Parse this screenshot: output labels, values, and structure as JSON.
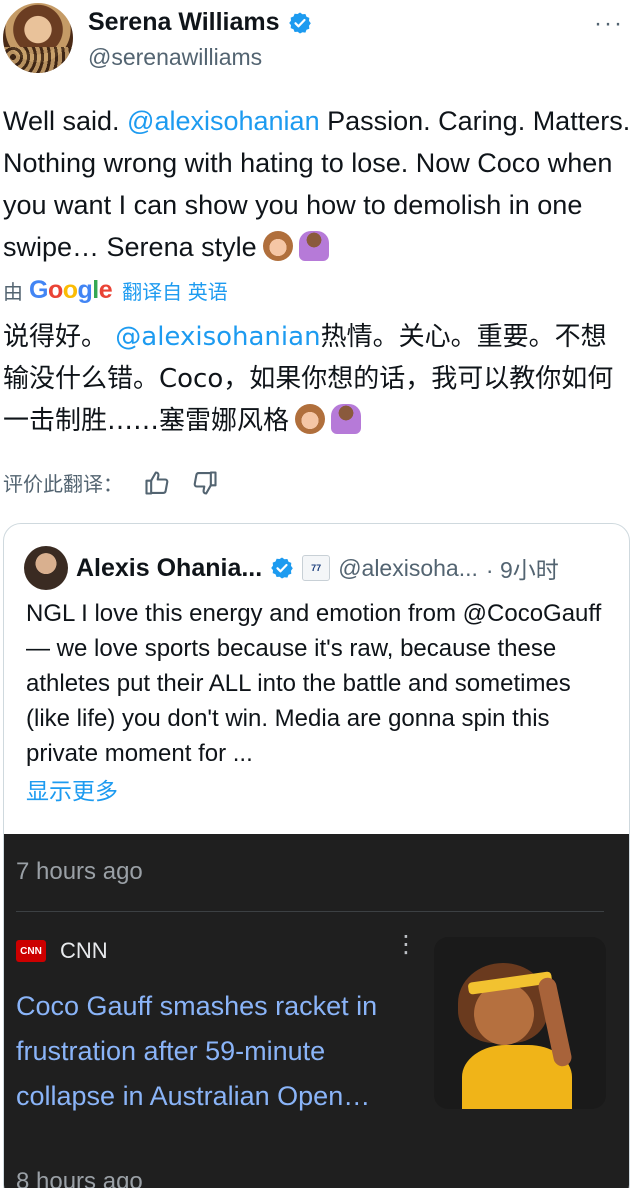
{
  "tweet": {
    "display_name": "Serena Williams",
    "handle": "@serenawilliams",
    "more_label": "···",
    "text_part1": "Well said. ",
    "mention": "@alexisohanian",
    "text_part2": " Passion. Caring. Matters. Nothing wrong with hating to lose. Now Coco when you want I can show you how to demolish in one swipe… Serena style"
  },
  "translation": {
    "by_label": "由",
    "provider": "Google",
    "source_link": "翻译自 英语",
    "text_part1": "说得好。 ",
    "mention": "@alexisohanian",
    "text_part2": "热情。关心。重要。不想输没什么错。Coco，如果你想的话，我可以教你如何一击制胜……塞雷娜风格",
    "rate_label": "评价此翻译："
  },
  "quote": {
    "display_name": "Alexis Ohania...",
    "handle": "@alexisoha...",
    "time": "· 9小时",
    "badge_text": "77",
    "text": "NGL I love this energy and emotion from @CocoGauff — we love sports because it's raw, because these athletes put their ALL into the battle and sometimes (like life) you don't win. Media are gonna spin this private moment for ...",
    "show_more": "显示更多"
  },
  "media": {
    "time_top": "7 hours ago",
    "source_logo": "CNN",
    "source_name": "CNN",
    "headline": "Coco Gauff smashes racket in frustration after 59-minute collapse in Australian Open…",
    "time_bottom": "8 hours ago"
  },
  "icons": {
    "verified": "verified-badge-icon",
    "more": "more-options-icon",
    "thumbs_up": "thumbs-up-icon",
    "thumbs_down": "thumbs-down-icon",
    "kebab": "kebab-menu-icon"
  },
  "colors": {
    "accent": "#1d9bf0",
    "text": "#0f1419",
    "secondary": "#536471",
    "media_bg": "#1f1f1f",
    "media_link": "#8ab4f8"
  }
}
